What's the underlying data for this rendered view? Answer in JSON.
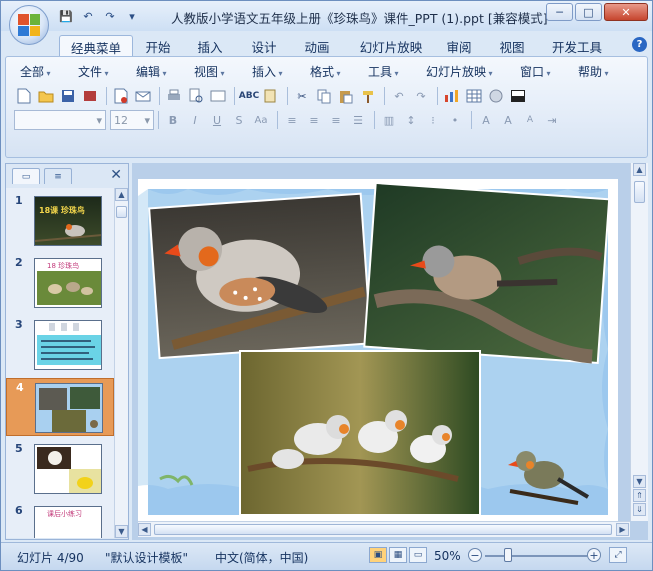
{
  "window": {
    "title": "人教版小学语文五年级上册《珍珠鸟》课件_PPT (1).ppt [兼容模式]",
    "controls": {
      "minimize": "─",
      "maximize": "□",
      "close": "✕"
    }
  },
  "quick_access": {
    "save_icon": "💾",
    "undo_icon": "↶",
    "redo_icon": "↷",
    "more_icon": "▾"
  },
  "ribbon_tabs": [
    "经典菜单",
    "开始",
    "插入",
    "设计",
    "动画",
    "幻灯片放映",
    "审阅",
    "视图",
    "开发工具"
  ],
  "classic_menu": [
    "全部",
    "文件",
    "编辑",
    "视图",
    "插入",
    "格式",
    "工具",
    "幻灯片放映",
    "窗口",
    "帮助"
  ],
  "font": {
    "name_value": "",
    "size_value": "12"
  },
  "panel_tabs": {
    "slides": "▭",
    "outline": "≡",
    "close": "✕"
  },
  "slides": [
    {
      "num": "1",
      "caption": "18课 珍珠鸟"
    },
    {
      "num": "2",
      "caption": "18 珍珠鸟"
    },
    {
      "num": "3",
      "caption": ""
    },
    {
      "num": "4",
      "caption": ""
    },
    {
      "num": "5",
      "caption": ""
    },
    {
      "num": "6",
      "caption": "课后小练习"
    }
  ],
  "selected_slide": "4",
  "status": {
    "slide_indicator": "幻灯片 4/90",
    "template": "\"默认设计模板\"",
    "language": "中文(简体，中国)",
    "zoom": "50%",
    "zoom_level": 0.5
  },
  "colors": {
    "accent": "#e79a57",
    "ribbon_blue": "#dbe8f6",
    "slide_bg_blue": "#9cc8ee"
  }
}
